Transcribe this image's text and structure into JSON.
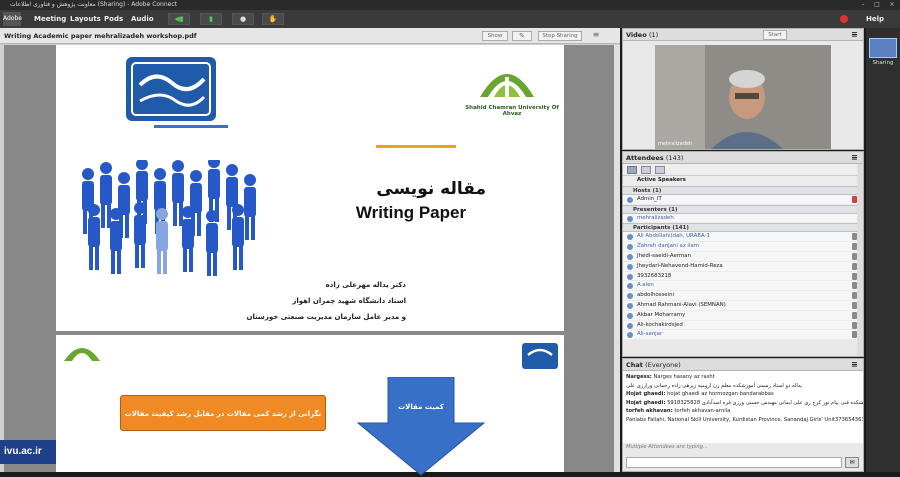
{
  "window": {
    "title": "معاونت پژوهش و فناوری اطلاعات (Sharing) - Adobe Connect"
  },
  "menu": {
    "logo": "Adobe",
    "meeting": "Meeting",
    "layouts": "Layouts",
    "pods": "Pods",
    "audio": "Audio",
    "help": "Help"
  },
  "share": {
    "title": "Writing Academic paper mehralizadeh workshop.pdf",
    "show_btn": "Show",
    "stop_btn": "Stop Sharing"
  },
  "slide1": {
    "uni_left_caption": "Shahid Chamran University Of Ahvaz",
    "title_fa": "مقاله نویسی",
    "title_en": "Writing Paper",
    "author_line1": "دکتر یداله مهرعلی زاده",
    "author_line2": "استاد دانشگاه شهید چمران اهواز",
    "author_line3": "و مدیر عامل سازمان مدیریت صنعتی خوزستان"
  },
  "slide2": {
    "box_text": "نگرانی از رشد کمی مقالات در مقابل رشد کیفیت مقالات",
    "arrow_text": "کمیت مقالات"
  },
  "watermark": "ivu.ac.ir",
  "video": {
    "title": "Video",
    "count": "(1)",
    "start_btn": "Start",
    "name_label": "mehralizadeh"
  },
  "attendees": {
    "title": "Attendees",
    "count": "(143)",
    "active_speakers": "Active Speakers",
    "hosts_label": "Hosts (1)",
    "hosts": [
      "Admin_IT"
    ],
    "presenters_label": "Presenters (1)",
    "presenters": [
      "mehralizadeh"
    ],
    "participants_label": "Participants (141)",
    "participants": [
      {
        "name": "Ali Abdollahi(dah, URABA-1",
        "blue": true
      },
      {
        "name": "Zahreh danjani az ilam",
        "blue": true
      },
      {
        "name": "Jhedi-saeidi-Aerman",
        "blue": false
      },
      {
        "name": "Jheydari-Nehavend-Hamid-Reza",
        "blue": false
      },
      {
        "name": "3932683218",
        "blue": false
      },
      {
        "name": "A.alen",
        "blue": true
      },
      {
        "name": "abdolhosseini",
        "blue": false
      },
      {
        "name": "Ahmad Rahmani-Alavi (SEMNAN)",
        "blue": false
      },
      {
        "name": "Akbar Moharramy",
        "blue": false
      },
      {
        "name": "Ali-kochakirdsjed",
        "blue": false
      },
      {
        "name": "Ali-sanjar",
        "blue": true
      }
    ]
  },
  "chat": {
    "title": "Chat",
    "count": "(Everyone)",
    "lines": [
      {
        "name": "Nargess:",
        "text": "Narges hasany az rasht"
      },
      {
        "name": "",
        "text": "یداله دو استاد رسمی آموزشکده معلم زن ارومیه زیرهی زاده رحمانی ورارزی علی"
      },
      {
        "name": "Hojat ghaedi:",
        "text": "hojat ghaedi az hormozgan bandarabbas"
      },
      {
        "name": "Hojat ghaedi:",
        "text": "5918325828 دوره دانشکده فنی پیام نور کرج ری علی ایمانی مهندس حسنی ورزی قره اسدآبادی"
      },
      {
        "name": "torfeh akhavan:",
        "text": "torfeh akhavan-arnila"
      },
      {
        "name": "",
        "text": "Paniabs Fallahi, National Skill University, Kurdistan Province, Sanandaj Girls' Unit3736543636"
      }
    ],
    "typing": "Multiple Attendees are typing..."
  },
  "sidepanel": {
    "sharing_label": "Sharing"
  }
}
